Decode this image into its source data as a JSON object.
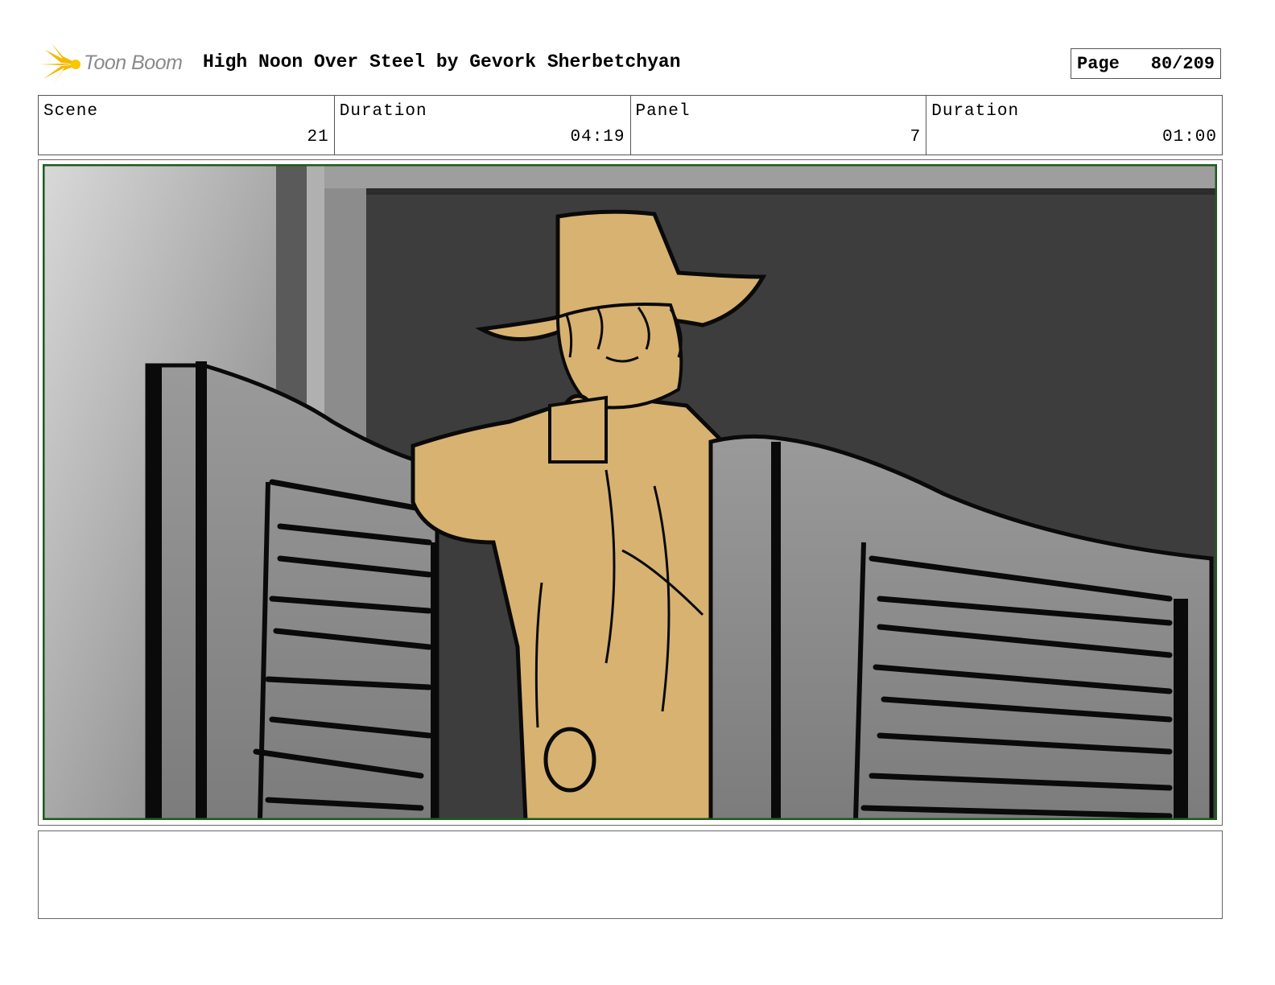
{
  "header": {
    "logo_text": "Toon Boom",
    "title": "High Noon Over Steel by Gevork Sherbetchyan",
    "page_label": "Page",
    "page_value": "80/209"
  },
  "info": {
    "scene_label": "Scene",
    "scene_value": "21",
    "scene_duration_label": "Duration",
    "scene_duration_value": "04:19",
    "panel_label": "Panel",
    "panel_value": "7",
    "panel_duration_label": "Duration",
    "panel_duration_value": "01:00"
  },
  "panel": {
    "palette": {
      "frame_border": "#1f5a1f",
      "wall_dark": "#3b3b3b",
      "door_gray": "#8c8c8c",
      "coat_tan": "#d8b271",
      "ink": "#0a0a0a"
    }
  },
  "notes": {
    "text": ""
  }
}
